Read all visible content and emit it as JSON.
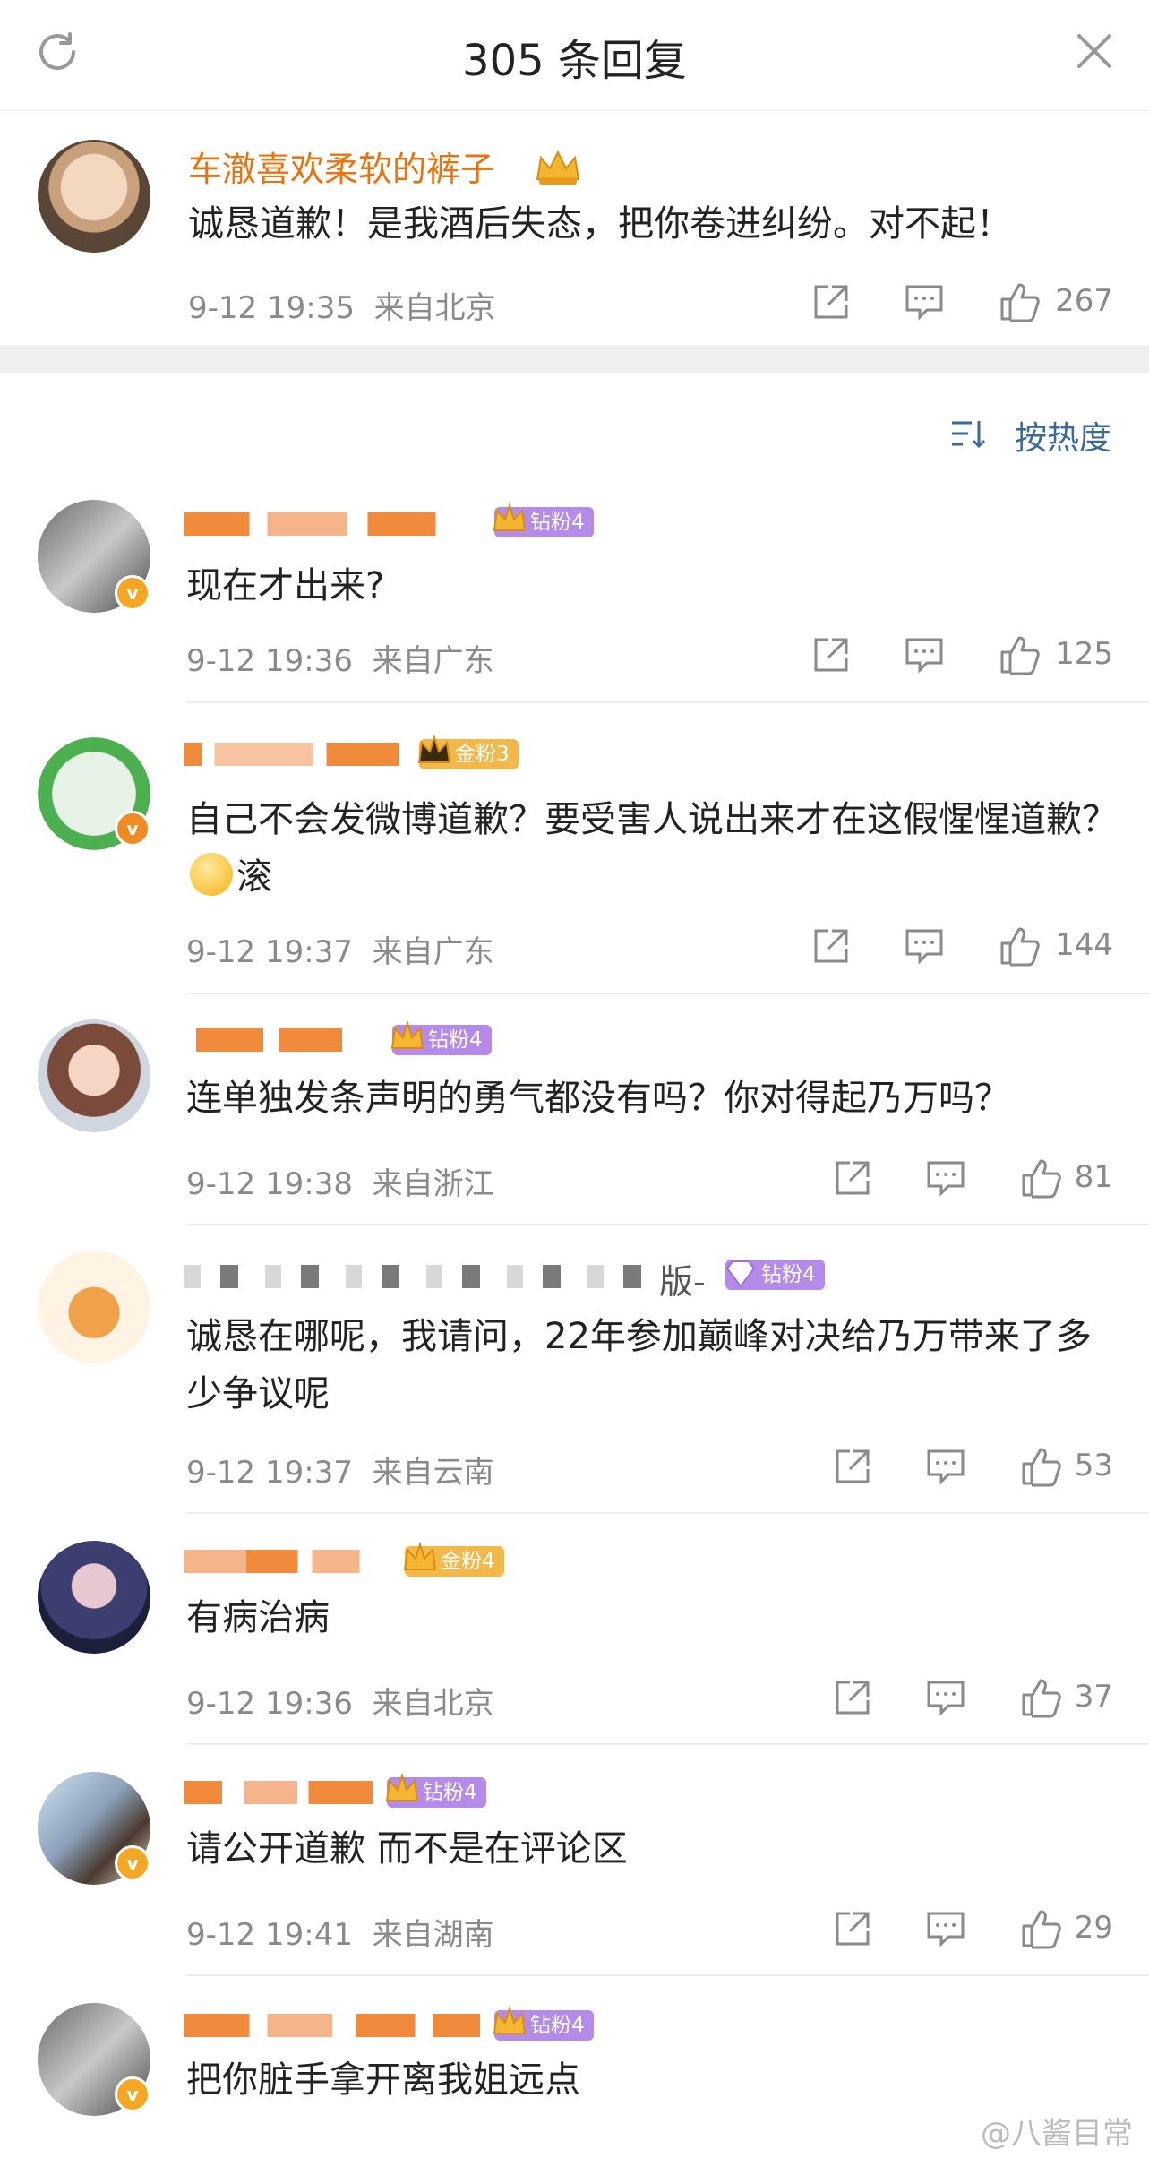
{
  "header": {
    "title": "305 条回复",
    "refresh_icon": "refresh-icon",
    "close_icon": "close-icon"
  },
  "top_comment": {
    "username": "车澈喜欢柔软的裤子",
    "text": "诚恳道歉！是我酒后失态，把你卷进纠纷。对不起！",
    "time": "9-12 19:35",
    "location": "来自北京",
    "likes": "267"
  },
  "sort": {
    "label": "按热度"
  },
  "replies": [
    {
      "username": "",
      "badge": "钻粉4",
      "text": "现在才出来?",
      "time": "9-12 19:36",
      "location": "来自广东",
      "likes": "125",
      "verified": true
    },
    {
      "username": "",
      "badge": "金粉3",
      "text": "自己不会发微博道歉？要受害人说出来才在这假惺惺道歉？",
      "text2": "滚",
      "time": "9-12 19:37",
      "location": "来自广东",
      "likes": "144",
      "verified": true
    },
    {
      "username": "",
      "badge": "钻粉4",
      "text": "连单独发条声明的勇气都没有吗？你对得起乃万吗？",
      "time": "9-12 19:38",
      "location": "来自浙江",
      "likes": "81",
      "verified": false
    },
    {
      "username": "版-",
      "badge": "钻粉4",
      "text": "诚恳在哪呢，我请问，22年参加巅峰对决给乃万带来了多少争议呢",
      "time": "9-12 19:37",
      "location": "来自云南",
      "likes": "53",
      "verified": false
    },
    {
      "username": "",
      "badge": "金粉4",
      "text": "有病治病",
      "time": "9-12 19:36",
      "location": "来自北京",
      "likes": "37",
      "verified": false
    },
    {
      "username": "",
      "badge": "钻粉4",
      "text": "请公开道歉 而不是在评论区",
      "time": "9-12 19:41",
      "location": "来自湖南",
      "likes": "29",
      "verified": true
    },
    {
      "username": "",
      "badge": "钻粉4",
      "text": "把你脏手拿开离我姐远点",
      "verified": true
    }
  ],
  "watermark": "@八酱目常",
  "colors": {
    "accent_orange": "#e8730f",
    "link_blue": "#3a6b96",
    "badge_purple": "#b48be8",
    "badge_gold": "#f2b84a"
  }
}
